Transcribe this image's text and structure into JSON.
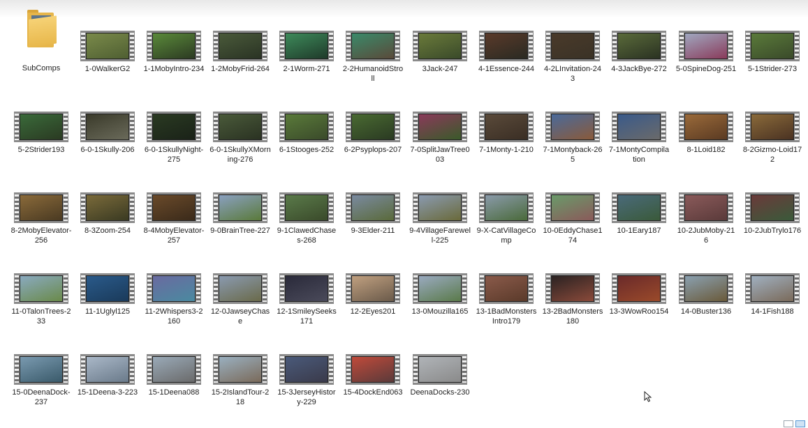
{
  "folder": {
    "label": "SubComps"
  },
  "files": [
    {
      "label": "1-0WalkerG2",
      "colors": [
        "#7a8a4a",
        "#4f5f32"
      ]
    },
    {
      "label": "1-1MobyIntro-234",
      "colors": [
        "#5a8a3a",
        "#2c3a22"
      ]
    },
    {
      "label": "1-2MobyFrid-264",
      "colors": [
        "#4a5a3a",
        "#2a3324"
      ]
    },
    {
      "label": "2-1Worm-271",
      "colors": [
        "#3d8a5a",
        "#1f3a2a"
      ]
    },
    {
      "label": "2-2HumanoidStroll",
      "colors": [
        "#3a8a6a",
        "#5a4a3a"
      ]
    },
    {
      "label": "3Jack-247",
      "colors": [
        "#6a7a3a",
        "#3a4a2a"
      ]
    },
    {
      "label": "4-1Essence-244",
      "colors": [
        "#5a3a2a",
        "#2a2a22"
      ]
    },
    {
      "label": "4-2LInvitation-243",
      "colors": [
        "#4a3a2a",
        "#3a3226"
      ]
    },
    {
      "label": "4-3JackBye-272",
      "colors": [
        "#5a6a3a",
        "#2a3222"
      ]
    },
    {
      "label": "5-0SpineDog-251",
      "colors": [
        "#a0a8c0",
        "#8a3a5a"
      ]
    },
    {
      "label": "5-1Strider-273",
      "colors": [
        "#5a7a3a",
        "#3a4a2a"
      ]
    },
    {
      "label": "5-2Strider193",
      "colors": [
        "#3a6a3a",
        "#2a3a22"
      ]
    },
    {
      "label": "6-0-1Skully-206",
      "colors": [
        "#3a3a2a",
        "#6a6a5a"
      ]
    },
    {
      "label": "6-0-1SkullyNight-275",
      "colors": [
        "#2a3a22",
        "#1a2218"
      ]
    },
    {
      "label": "6-0-1SkullyXMorning-276",
      "colors": [
        "#4a5a3a",
        "#2a3222"
      ]
    },
    {
      "label": "6-1Stooges-252",
      "colors": [
        "#5a7a3a",
        "#3a4a2a"
      ]
    },
    {
      "label": "6-2Psyplops-207",
      "colors": [
        "#4a6a32",
        "#2a3a22"
      ]
    },
    {
      "label": "7-0SplitJawTree003",
      "colors": [
        "#8a3a5a",
        "#3a5a2a"
      ]
    },
    {
      "label": "7-1Monty-1-210",
      "colors": [
        "#5a4a3a",
        "#3a2e24"
      ]
    },
    {
      "label": "7-1Montyback-265",
      "colors": [
        "#4a6a9a",
        "#8a5a3a"
      ]
    },
    {
      "label": "7-1MontyCompilation",
      "colors": [
        "#3a5a8a",
        "#6a6a6a"
      ]
    },
    {
      "label": "8-1Loid182",
      "colors": [
        "#9a6a3a",
        "#5a3a22"
      ]
    },
    {
      "label": "8-2Gizmo-Loid172",
      "colors": [
        "#8a6a3a",
        "#4a3222"
      ]
    },
    {
      "label": "8-2MobyElevator-256",
      "colors": [
        "#8a6a3a",
        "#4a3a22"
      ]
    },
    {
      "label": "8-3Zoom-254",
      "colors": [
        "#7a6a3a",
        "#3a3a22"
      ]
    },
    {
      "label": "8-4MobyElevator-257",
      "colors": [
        "#6a4a2a",
        "#3a2a1a"
      ]
    },
    {
      "label": "9-0BrainTree-227",
      "colors": [
        "#8aa0c0",
        "#5a7a3a"
      ]
    },
    {
      "label": "9-1ClawedChases-268",
      "colors": [
        "#5a7a4a",
        "#3a4a2a"
      ]
    },
    {
      "label": "9-3Elder-211",
      "colors": [
        "#7a8aa0",
        "#5a6a3a"
      ]
    },
    {
      "label": "9-4VillageFarewell-225",
      "colors": [
        "#8a9ab0",
        "#6a6a3a"
      ]
    },
    {
      "label": "9-X-CatVillageComp",
      "colors": [
        "#8a9aaa",
        "#4a6a3a"
      ]
    },
    {
      "label": "10-0EddyChase174",
      "colors": [
        "#6a9a6a",
        "#8a5a5a"
      ]
    },
    {
      "label": "10-1Eary187",
      "colors": [
        "#4a6a7a",
        "#3a5a3a"
      ]
    },
    {
      "label": "10-2JubMoby-216",
      "colors": [
        "#8a5a5a",
        "#5a3a3a"
      ]
    },
    {
      "label": "10-2JubTrylo176",
      "colors": [
        "#6a3a3a",
        "#3a5a3a"
      ]
    },
    {
      "label": "11-0TalonTrees-233",
      "colors": [
        "#8aaac0",
        "#6a8a4a"
      ]
    },
    {
      "label": "11-1Uglyl125",
      "colors": [
        "#2a5a8a",
        "#1a3a5a"
      ]
    },
    {
      "label": "11-2Whispers3-2160",
      "colors": [
        "#6a6aa0",
        "#4a8aa0"
      ]
    },
    {
      "label": "12-0JawseyChase",
      "colors": [
        "#8a9ab0",
        "#6a6a4a"
      ]
    },
    {
      "label": "12-1SmileySeeks171",
      "colors": [
        "#2a2a3a",
        "#4a4a5a"
      ]
    },
    {
      "label": "12-2Eyes201",
      "colors": [
        "#c0a080",
        "#6a5a4a"
      ]
    },
    {
      "label": "13-0Mouzilla165",
      "colors": [
        "#9aaac0",
        "#5a7a4a"
      ]
    },
    {
      "label": "13-1BadMonstersIntro179",
      "colors": [
        "#8a5a4a",
        "#5a3a2a"
      ]
    },
    {
      "label": "13-2BadMonsters180",
      "colors": [
        "#2a2222",
        "#8a4a3a"
      ]
    },
    {
      "label": "13-3WowRoo154",
      "colors": [
        "#6a2a2a",
        "#9a4a2a"
      ]
    },
    {
      "label": "14-0Buster136",
      "colors": [
        "#8aa0b0",
        "#6a5a3a"
      ]
    },
    {
      "label": "14-1Fish188",
      "colors": [
        "#a0b0c0",
        "#7a6a5a"
      ]
    },
    {
      "label": "15-0DeenaDock-237",
      "colors": [
        "#7a9ab0",
        "#3a5a6a"
      ]
    },
    {
      "label": "15-1Deena-3-223",
      "colors": [
        "#aab8c8",
        "#6a7a8a"
      ]
    },
    {
      "label": "15-1Deena088",
      "colors": [
        "#9aaab8",
        "#6a6a6a"
      ]
    },
    {
      "label": "15-2IslandTour-218",
      "colors": [
        "#9ab0c0",
        "#7a6a5a"
      ]
    },
    {
      "label": "15-3JerseyHistory-229",
      "colors": [
        "#4a5a7a",
        "#3a3a4a"
      ]
    },
    {
      "label": "15-4DockEnd063",
      "colors": [
        "#c04a3a",
        "#5a3a3a"
      ]
    },
    {
      "label": "DeenaDocks-230",
      "colors": [
        "#b0b4b8",
        "#8a8a8a"
      ]
    }
  ],
  "colors": {
    "label_text": "#1e1e1e",
    "film_strip": "#8b8b8b",
    "folder": "#e8b84c"
  }
}
